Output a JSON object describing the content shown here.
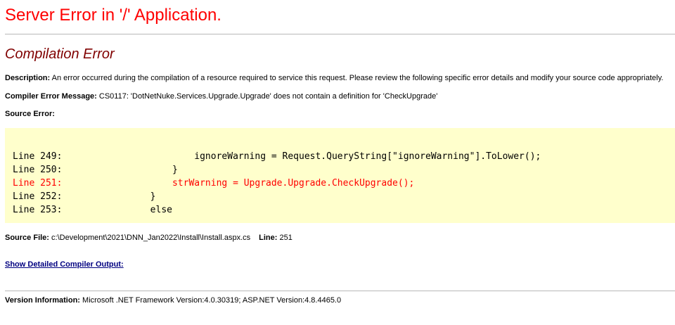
{
  "header": {
    "title": "Server Error in '/' Application."
  },
  "error": {
    "subtitle": "Compilation Error",
    "description_label": "Description:",
    "description_text": " An error occurred during the compilation of a resource required to service this request. Please review the following specific error details and modify your source code appropriately.",
    "compiler_message_label": "Compiler Error Message:",
    "compiler_message_text": " CS0117: 'DotNetNuke.Services.Upgrade.Upgrade' does not contain a definition for 'CheckUpgrade'",
    "source_error_label": "Source Error:"
  },
  "source_code": {
    "lines": [
      {
        "text": "Line 249:                        ignoreWarning = Request.QueryString[\"ignoreWarning\"].ToLower();",
        "highlighted": false
      },
      {
        "text": "Line 250:                    }",
        "highlighted": false
      },
      {
        "text": "Line 251:                    strWarning = Upgrade.Upgrade.CheckUpgrade();",
        "highlighted": true
      },
      {
        "text": "Line 252:                }",
        "highlighted": false
      },
      {
        "text": "Line 253:                else",
        "highlighted": false
      }
    ]
  },
  "source_file": {
    "file_label": "Source File:",
    "file_value": " c:\\Development\\2021\\DNN_Jan2022\\Install\\Install.aspx.cs",
    "line_label": "Line:",
    "line_value": " 251"
  },
  "compiler_output": {
    "link_label": "Show Detailed Compiler Output:"
  },
  "version": {
    "label": "Version Information:",
    "text": " Microsoft .NET Framework Version:4.0.30319; ASP.NET Version:4.8.4465.0"
  },
  "colors": {
    "title": "#ff0000",
    "subtitle": "#800000",
    "code_background": "#ffffcc",
    "error_line": "#ff0000",
    "link": "#000080"
  }
}
